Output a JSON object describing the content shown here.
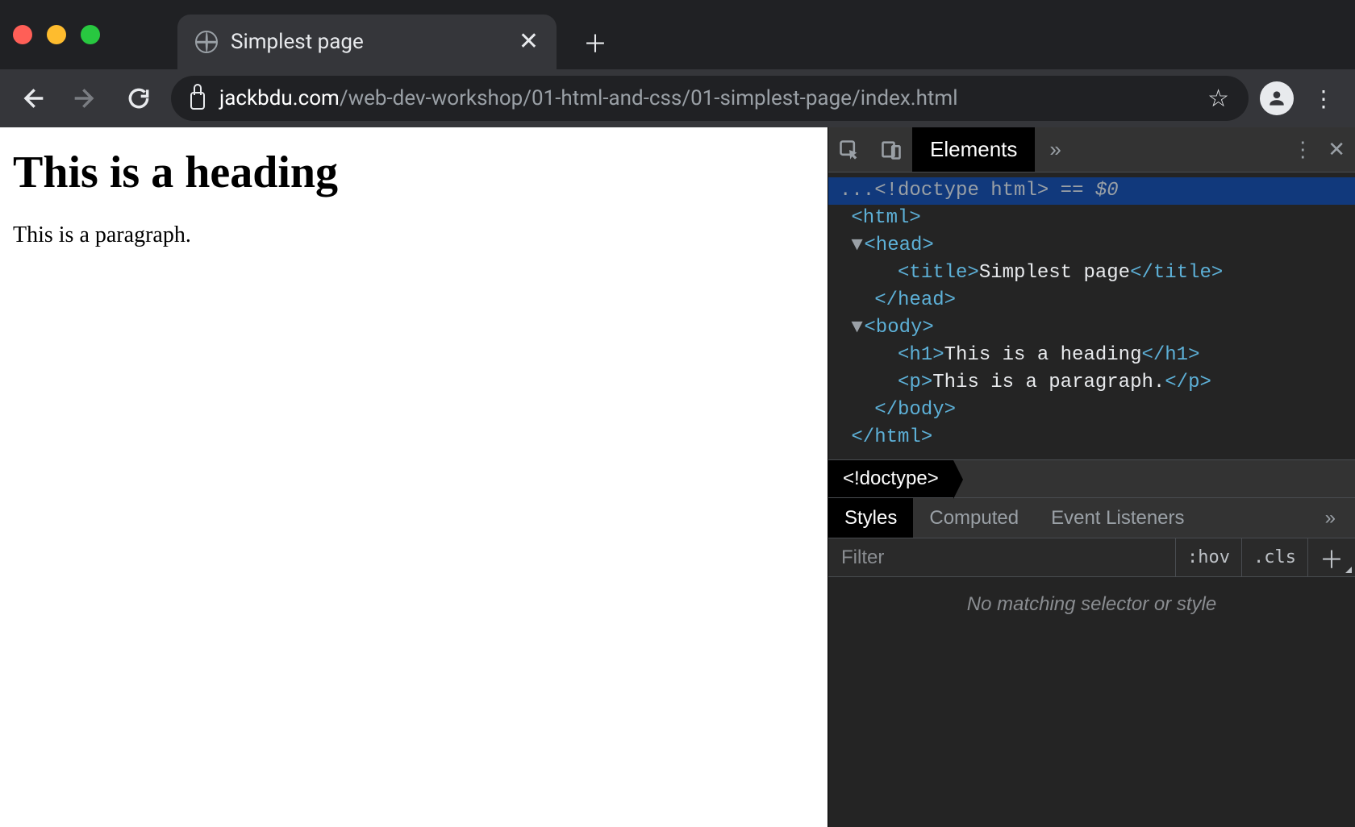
{
  "tab": {
    "title": "Simplest page"
  },
  "url": {
    "host": "jackbdu.com",
    "path": "/web-dev-workshop/01-html-and-css/01-simplest-page/index.html"
  },
  "page": {
    "heading": "This is a heading",
    "paragraph": "This is a paragraph."
  },
  "devtools": {
    "top_tabs": {
      "elements": "Elements",
      "more": "»"
    },
    "dom": {
      "line_selected_ellipsis": "...",
      "doctype": "<!doctype html>",
      "eq": " == ",
      "dollar0": "$0",
      "html_open": "<html>",
      "head_open": "<head>",
      "title_open": "<title>",
      "title_text": "Simplest page",
      "title_close": "</title>",
      "head_close": "</head>",
      "body_open": "<body>",
      "h1_open": "<h1>",
      "h1_text": "This is a heading",
      "h1_close": "</h1>",
      "p_open": "<p>",
      "p_text": "This is a paragraph.",
      "p_close": "</p>",
      "body_close": "</body>",
      "html_close": "</html>"
    },
    "breadcrumb": "<!doctype>",
    "sub_tabs": {
      "styles": "Styles",
      "computed": "Computed",
      "event_listeners": "Event Listeners",
      "more": "»"
    },
    "filter_placeholder": "Filter",
    "toggles": {
      "hov": ":hov",
      "cls": ".cls",
      "add": "＋"
    },
    "styles_empty": "No matching selector or style"
  }
}
